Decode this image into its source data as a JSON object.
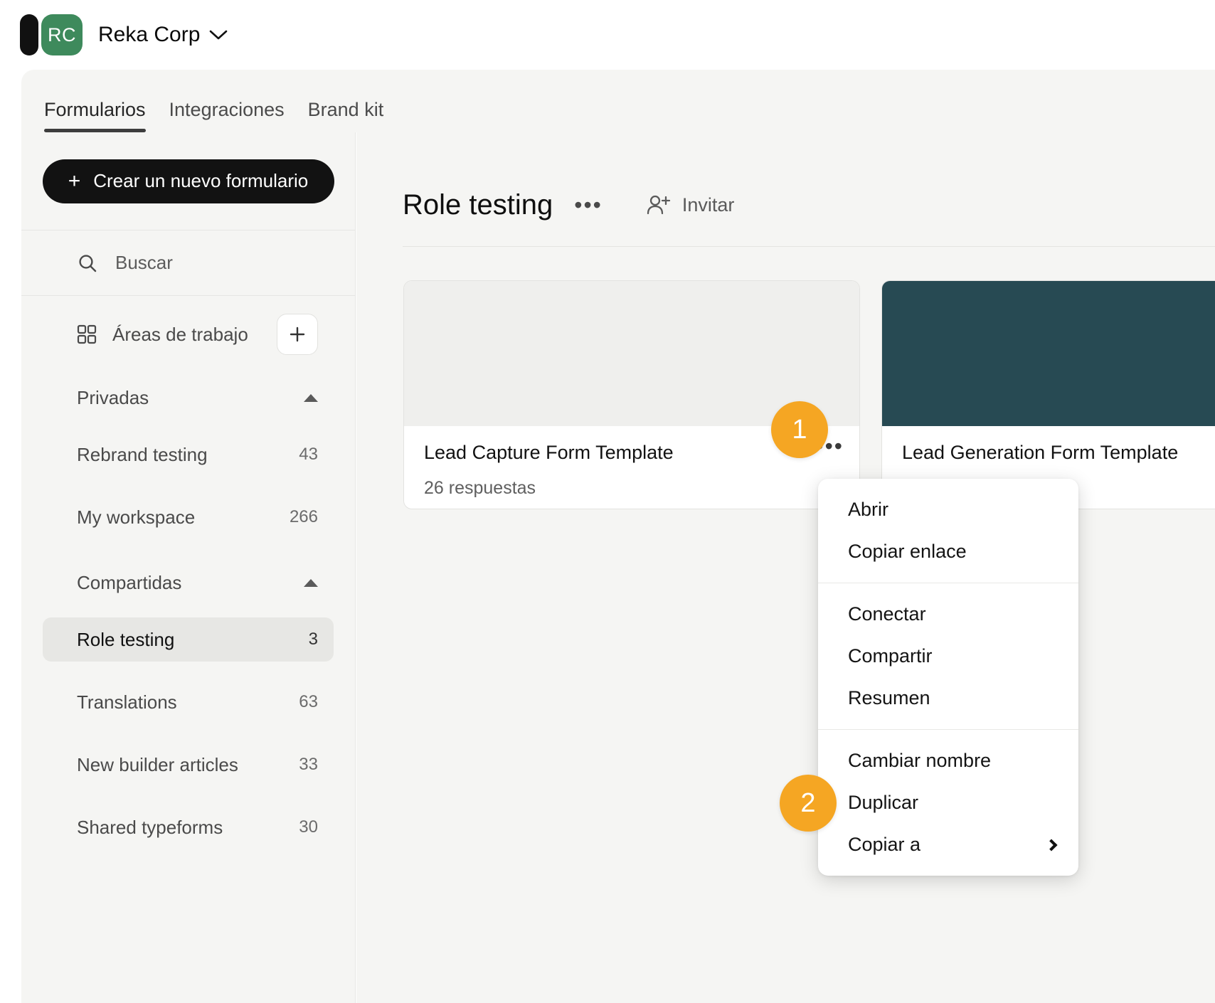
{
  "topbar": {
    "avatar_initials": "RC",
    "org_name": "Reka Corp",
    "caret_icon": "chevron-down-icon"
  },
  "tabs": [
    {
      "label": "Formularios",
      "active": true
    },
    {
      "label": "Integraciones",
      "active": false
    },
    {
      "label": "Brand kit",
      "active": false
    }
  ],
  "sidebar": {
    "create_button": "Crear un nuevo formulario",
    "create_icon": "plus-icon",
    "search": {
      "placeholder": "Buscar",
      "icon": "search-icon",
      "value": ""
    },
    "workspaces_header": {
      "label": "Áreas de trabajo",
      "icon": "grid-icon",
      "add_icon": "plus-icon",
      "add_label": "+"
    },
    "groups": [
      {
        "label": "Privadas",
        "collapse_icon": "triangle-up-icon",
        "items": [
          {
            "name": "Rebrand testing",
            "count": "43",
            "selected": false
          },
          {
            "name": "My workspace",
            "count": "266",
            "selected": false
          }
        ]
      },
      {
        "label": "Compartidas",
        "collapse_icon": "triangle-up-icon",
        "items": [
          {
            "name": "Role testing",
            "count": "3",
            "selected": true
          },
          {
            "name": "Translations",
            "count": "63",
            "selected": false
          },
          {
            "name": "New builder articles",
            "count": "33",
            "selected": false
          },
          {
            "name": "Shared typeforms",
            "count": "30",
            "selected": false
          }
        ]
      }
    ]
  },
  "main": {
    "title": "Role testing",
    "title_menu_icon": "ellipsis-icon",
    "title_menu_label": "•••",
    "invite": {
      "label": "Invitar",
      "icon": "person-add-icon"
    },
    "cards": [
      {
        "title": "Lead Capture Form Template",
        "responses": "26 respuestas",
        "thumb_style": "grey",
        "menu_icon": "ellipsis-icon",
        "menu_label": "•••"
      },
      {
        "title": "Lead Generation Form Template",
        "responses": "",
        "thumb_style": "teal",
        "menu_icon": "ellipsis-icon",
        "menu_label": ""
      }
    ]
  },
  "context_menu": {
    "groups": [
      [
        {
          "label": "Abrir"
        },
        {
          "label": "Copiar enlace"
        }
      ],
      [
        {
          "label": "Conectar"
        },
        {
          "label": "Compartir"
        },
        {
          "label": "Resumen"
        }
      ],
      [
        {
          "label": "Cambiar nombre"
        },
        {
          "label": "Duplicar"
        },
        {
          "label": "Copiar a",
          "submenu_icon": "chevron-right-icon"
        }
      ]
    ]
  },
  "step_badges": [
    {
      "number": "1"
    },
    {
      "number": "2"
    }
  ],
  "colors": {
    "brand_green": "#3e8a5c",
    "brand_black": "#121212",
    "badge_orange": "#f5a623",
    "card_teal": "#274a53",
    "surface": "#f5f5f3"
  }
}
